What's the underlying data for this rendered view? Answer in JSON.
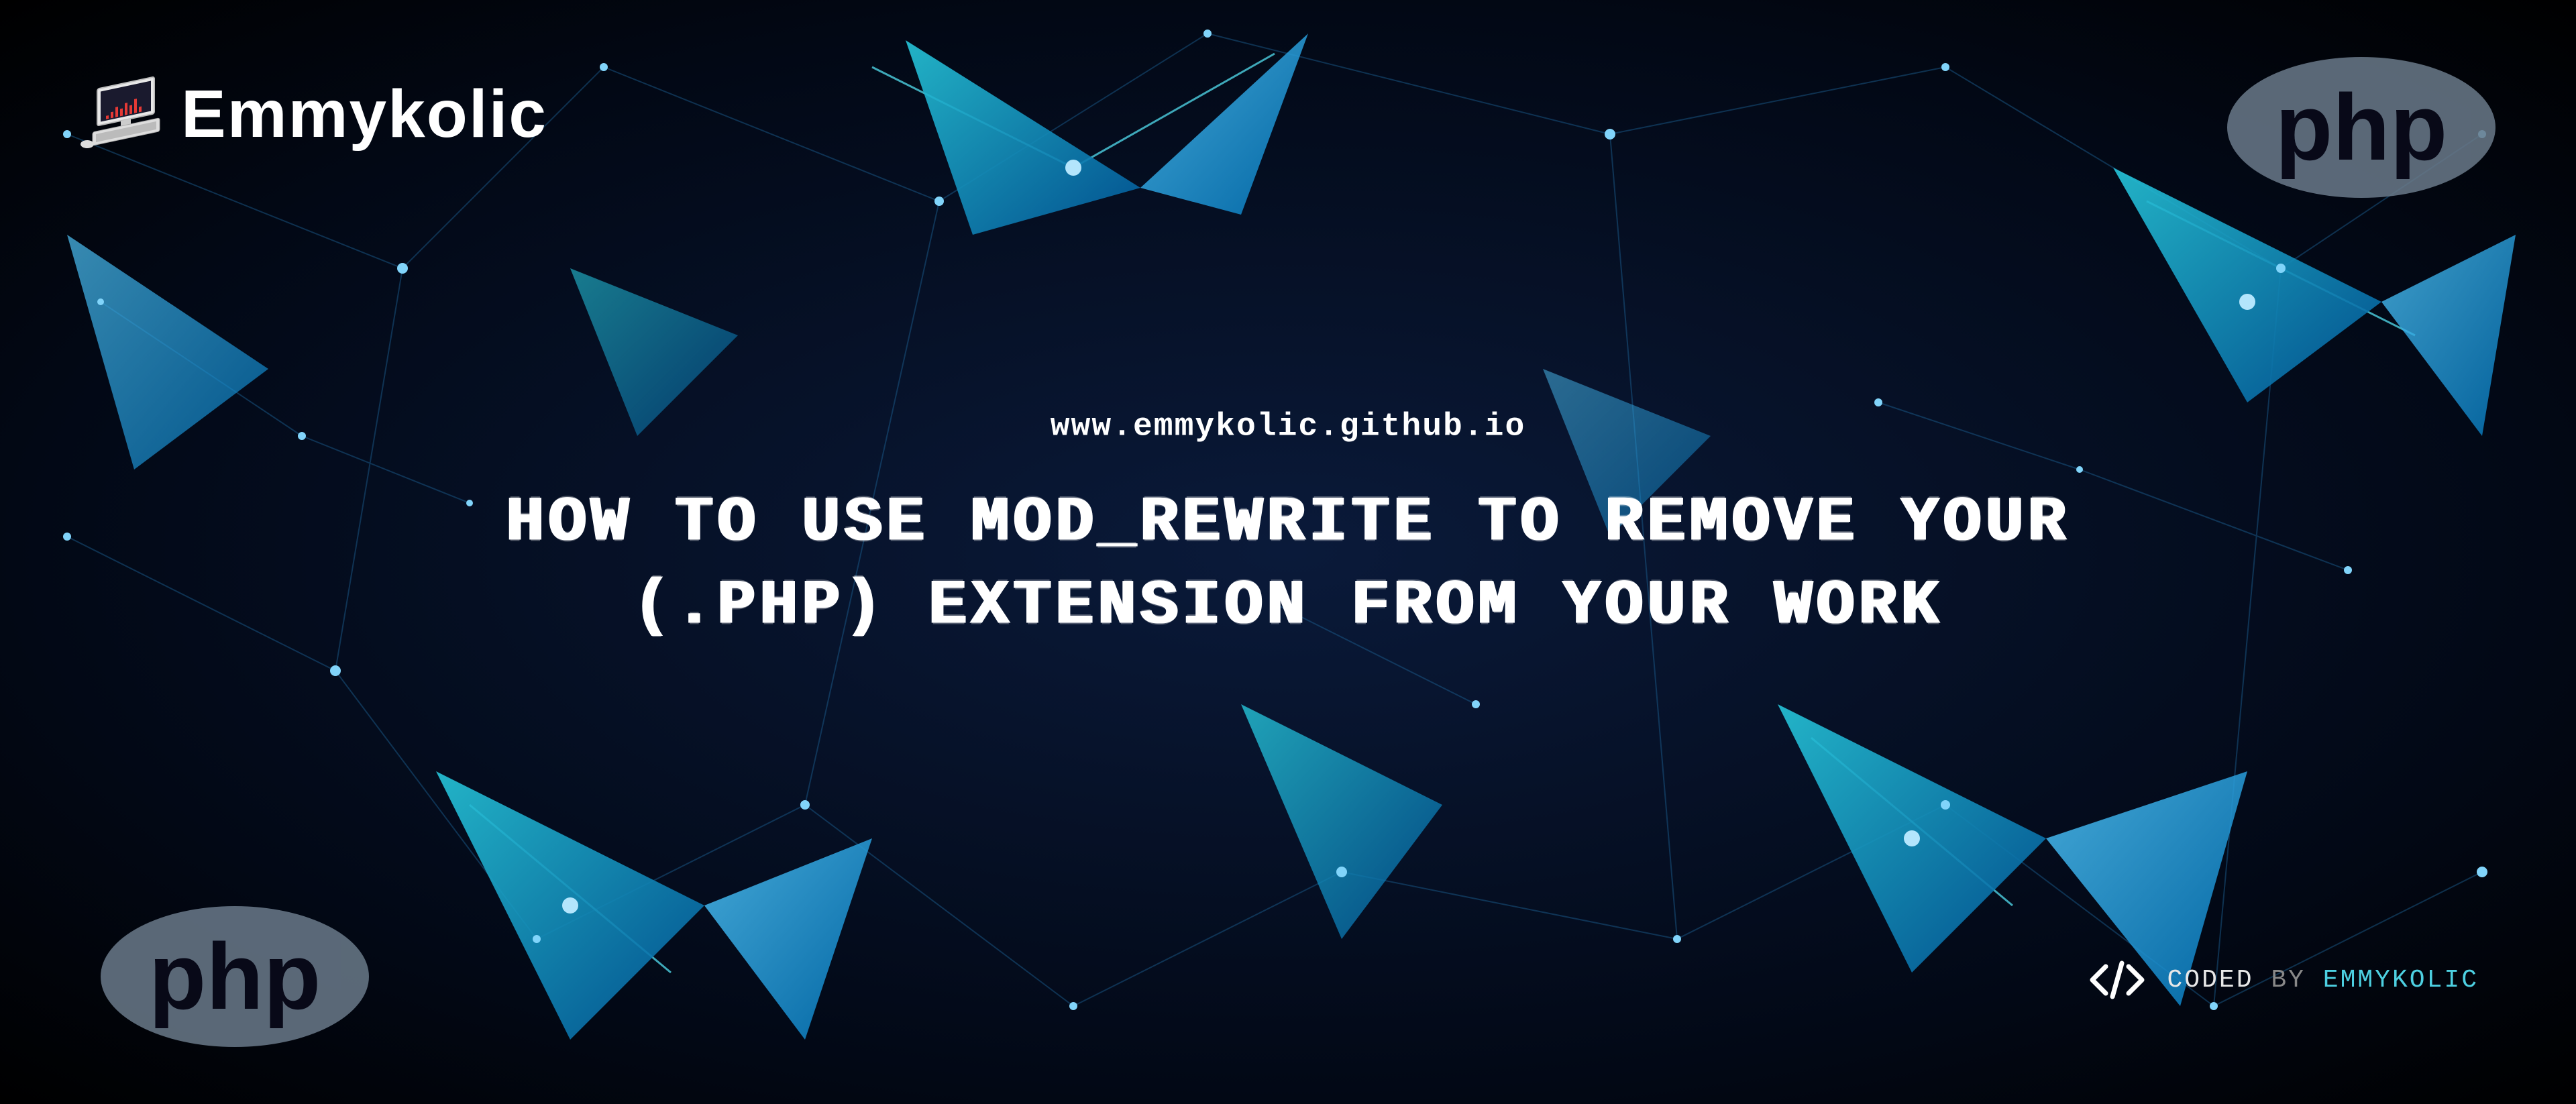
{
  "brand": {
    "name": "Emmykolic"
  },
  "url": "www.emmykolic.github.io",
  "title": "HOW TO USE MOD_REWRITE TO REMOVE YOUR (.PHP) EXTENSION FROM YOUR WORK",
  "php_label": "php",
  "footer": {
    "coded": "CODED",
    "by": "BY",
    "author": "EMMYKOLIC"
  }
}
